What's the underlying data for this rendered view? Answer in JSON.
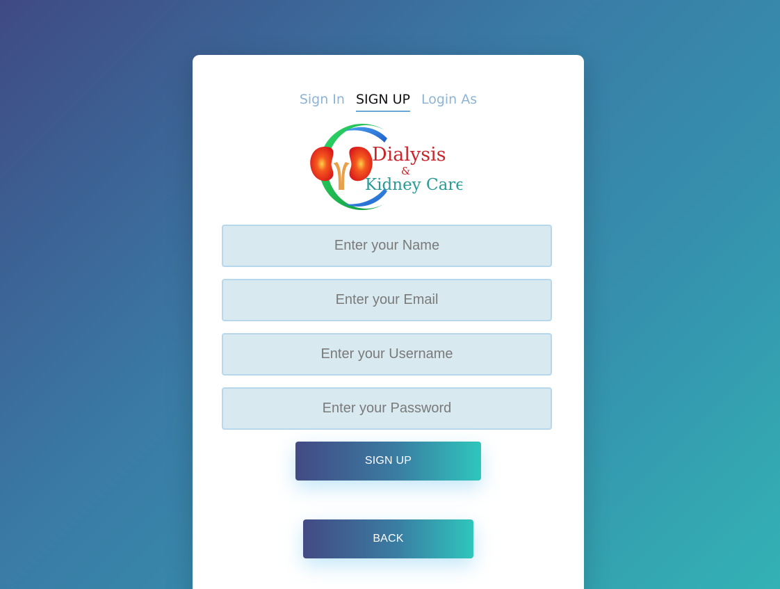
{
  "tabs": [
    {
      "label": "Sign In",
      "active": false
    },
    {
      "label": "SIGN UP",
      "active": true
    },
    {
      "label": "Login As",
      "active": false
    }
  ],
  "logo": {
    "line1": "Dialysis",
    "line2": "&",
    "line3": "Kidney Care"
  },
  "form": {
    "name_placeholder": "Enter your Name",
    "email_placeholder": "Enter your Email",
    "username_placeholder": "Enter your Username",
    "password_placeholder": "Enter your Password"
  },
  "buttons": {
    "signup_label": "SIGN UP",
    "back_label": "BACK"
  },
  "colors": {
    "accent_start": "#434a84",
    "accent_end": "#2fc6bc",
    "logo_red": "#c8262b",
    "logo_teal": "#2a9a95"
  }
}
